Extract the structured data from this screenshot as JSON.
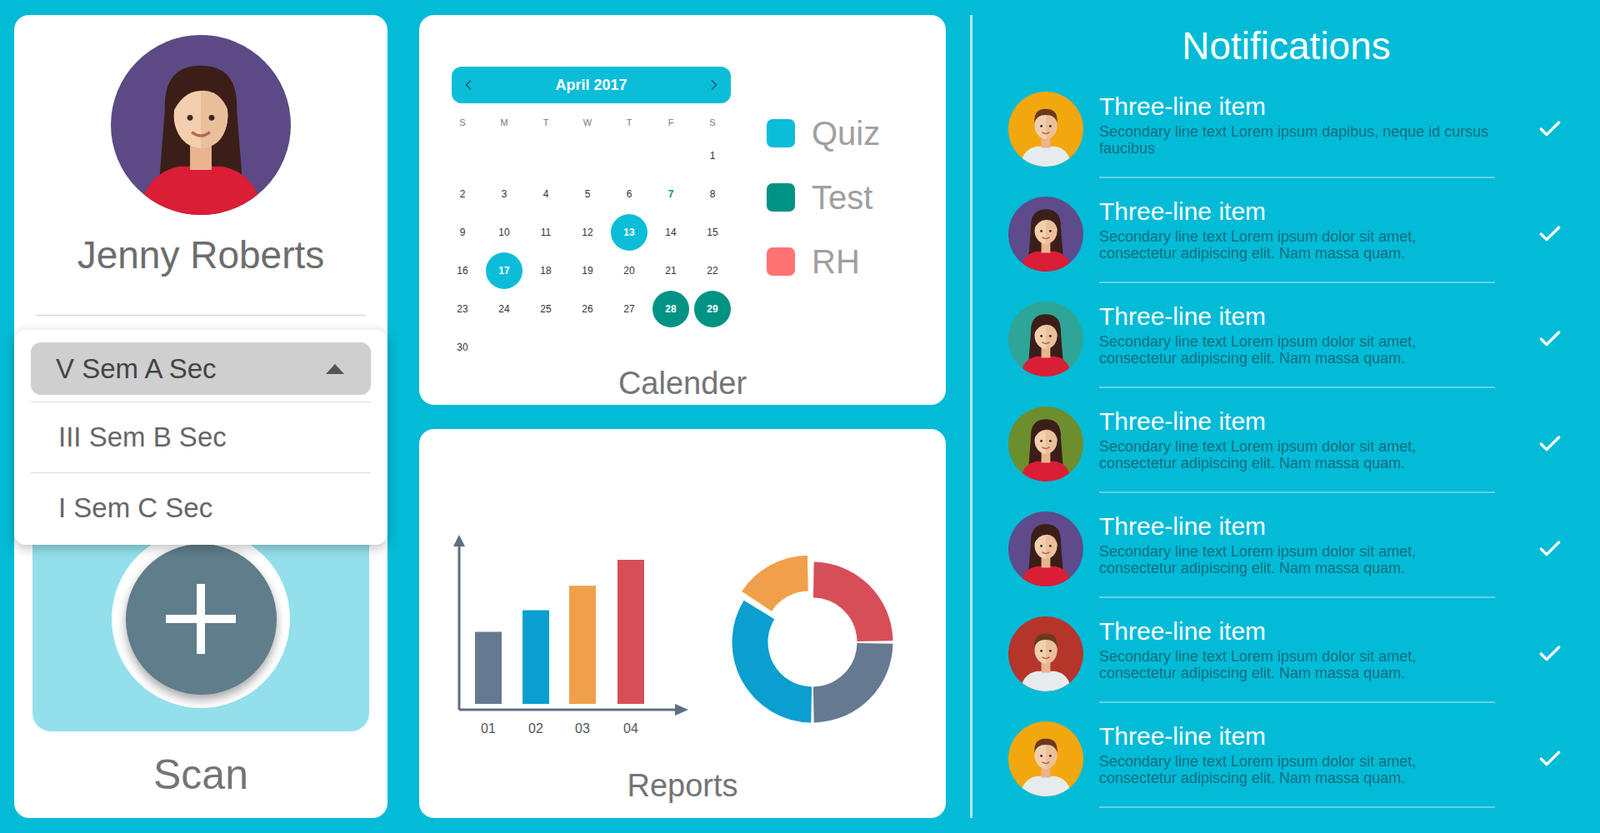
{
  "profile": {
    "name": "Jenny Roberts",
    "avatar_color": "#5b4a85",
    "avatar_kind": "woman"
  },
  "semester_menu": {
    "expanded": true,
    "options": [
      {
        "label": "V Sem A Sec",
        "selected": true
      },
      {
        "label": "III Sem B Sec",
        "selected": false
      },
      {
        "label": "I Sem C Sec",
        "selected": false
      }
    ]
  },
  "scan": {
    "label": "Scan"
  },
  "calendar": {
    "month": "April 2017",
    "weekdays": [
      "S",
      "M",
      "T",
      "W",
      "T",
      "F",
      "S"
    ],
    "weeks": [
      [
        {
          "day": "",
          "event": "",
          "today": false
        },
        {
          "day": "",
          "event": "",
          "today": false
        },
        {
          "day": "",
          "event": "",
          "today": false
        },
        {
          "day": "",
          "event": "",
          "today": false
        },
        {
          "day": "",
          "event": "",
          "today": false
        },
        {
          "day": "",
          "event": "",
          "today": false
        },
        {
          "day": "1",
          "event": "",
          "today": false
        }
      ],
      [
        {
          "day": "2",
          "event": "",
          "today": false
        },
        {
          "day": "3",
          "event": "",
          "today": false
        },
        {
          "day": "4",
          "event": "",
          "today": false
        },
        {
          "day": "5",
          "event": "",
          "today": false
        },
        {
          "day": "6",
          "event": "",
          "today": false
        },
        {
          "day": "7",
          "event": "",
          "today": true
        },
        {
          "day": "8",
          "event": "",
          "today": false
        }
      ],
      [
        {
          "day": "9",
          "event": "",
          "today": false
        },
        {
          "day": "10",
          "event": "",
          "today": false
        },
        {
          "day": "11",
          "event": "",
          "today": false
        },
        {
          "day": "12",
          "event": "",
          "today": false
        },
        {
          "day": "13",
          "event": "Quiz",
          "today": false
        },
        {
          "day": "14",
          "event": "",
          "today": false
        },
        {
          "day": "15",
          "event": "",
          "today": false
        }
      ],
      [
        {
          "day": "16",
          "event": "",
          "today": false
        },
        {
          "day": "17",
          "event": "Quiz",
          "today": false
        },
        {
          "day": "18",
          "event": "",
          "today": false
        },
        {
          "day": "19",
          "event": "",
          "today": false
        },
        {
          "day": "20",
          "event": "",
          "today": false
        },
        {
          "day": "21",
          "event": "",
          "today": false
        },
        {
          "day": "22",
          "event": "",
          "today": false
        }
      ],
      [
        {
          "day": "23",
          "event": "",
          "today": false
        },
        {
          "day": "24",
          "event": "",
          "today": false
        },
        {
          "day": "25",
          "event": "",
          "today": false
        },
        {
          "day": "26",
          "event": "",
          "today": false
        },
        {
          "day": "27",
          "event": "",
          "today": false
        },
        {
          "day": "28",
          "event": "Test",
          "today": false
        },
        {
          "day": "29",
          "event": "Test",
          "today": false
        }
      ],
      [
        {
          "day": "30",
          "event": "",
          "today": false
        }
      ]
    ],
    "legend": [
      {
        "label": "Quiz",
        "color": "#0bbdd9"
      },
      {
        "label": "Test",
        "color": "#009384"
      },
      {
        "label": "RH",
        "color": "#ff7373"
      }
    ],
    "caption": "Calender"
  },
  "reports": {
    "bars": [
      {
        "label": "01",
        "value": 50,
        "color": "#657a91"
      },
      {
        "label": "02",
        "value": 65,
        "color": "#0a9fcf"
      },
      {
        "label": "03",
        "value": 82,
        "color": "#f0a04b"
      },
      {
        "label": "04",
        "value": 100,
        "color": "#d64f58"
      }
    ],
    "donut": [
      {
        "value": 25,
        "color": "#d64f58",
        "exploded": false
      },
      {
        "value": 25,
        "color": "#657a91",
        "exploded": false
      },
      {
        "value": 34,
        "color": "#0a9fcf",
        "exploded": false
      },
      {
        "value": 16,
        "color": "#f0a04b",
        "exploded": true
      }
    ],
    "caption": "Reports"
  },
  "notifications": {
    "title": "Notifications",
    "items": [
      {
        "title": "Three-line item",
        "text": "Secondary line text Lorem ipsum dapibus, neque id cursus faucibus",
        "color": "#f3a70f",
        "kind": "man",
        "checked": true
      },
      {
        "title": "Three-line item",
        "text": "Secondary line text Lorem ipsum dolor sit amet, consectetur adipiscing elit. Nam massa quam.",
        "color": "#5d4b8c",
        "kind": "woman",
        "checked": true
      },
      {
        "title": "Three-line item",
        "text": "Secondary line text Lorem ipsum dolor sit amet, consectetur adipiscing elit. Nam massa quam.",
        "color": "#2ea596",
        "kind": "woman",
        "checked": true
      },
      {
        "title": "Three-line item",
        "text": "Secondary line text Lorem ipsum dolor sit amet, consectetur adipiscing elit. Nam massa quam.",
        "color": "#6d8e2d",
        "kind": "woman",
        "checked": true
      },
      {
        "title": "Three-line item",
        "text": "Secondary line text Lorem ipsum dolor sit amet, consectetur adipiscing elit. Nam massa quam.",
        "color": "#5d4b8c",
        "kind": "woman",
        "checked": true
      },
      {
        "title": "Three-line item",
        "text": "Secondary line text Lorem ipsum dolor sit amet, consectetur adipiscing elit. Nam massa quam.",
        "color": "#b5352b",
        "kind": "man",
        "checked": true
      },
      {
        "title": "Three-line item",
        "text": "Secondary line text Lorem ipsum dolor sit amet, consectetur adipiscing elit. Nam massa quam.",
        "color": "#f3a70f",
        "kind": "man",
        "checked": true
      }
    ]
  }
}
